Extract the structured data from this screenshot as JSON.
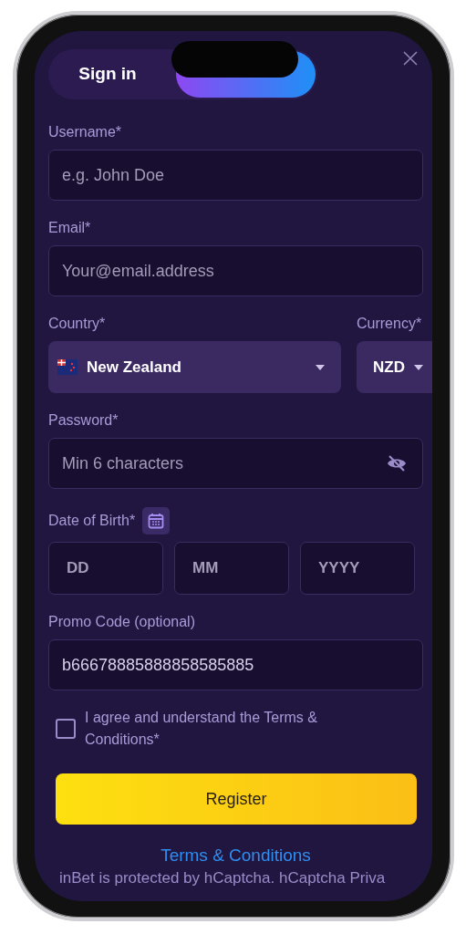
{
  "tabs": [
    {
      "label": "Sign in",
      "selected": false
    },
    {
      "selected": true
    }
  ],
  "fields": [
    {
      "label": "Username*",
      "placeholder": "e.g. John Doe"
    },
    {
      "label": "Email*",
      "placeholder": "Your@email.address"
    }
  ],
  "country": {
    "label": "Country*",
    "value": "New Zealand"
  },
  "currency": {
    "label": "Currency*",
    "value": "NZD"
  },
  "password": {
    "label": "Password*",
    "placeholder": "Min 6 characters"
  },
  "date_of_birth": {
    "label": "Date of Birth*",
    "parts": [
      {
        "placeholder": "DD"
      },
      {
        "placeholder": "MM"
      },
      {
        "placeholder": "YYYY"
      }
    ]
  },
  "promo": {
    "label": "Promo Code (optional)",
    "value": "b66678885888858585885"
  },
  "agree": {
    "label": "I agree and understand the Terms & Conditions*",
    "checked": false
  },
  "register_button": "Register",
  "terms_link": "Terms & Conditions",
  "footer_text": "inBet is protected by hCaptcha. hCaptcha Priva"
}
